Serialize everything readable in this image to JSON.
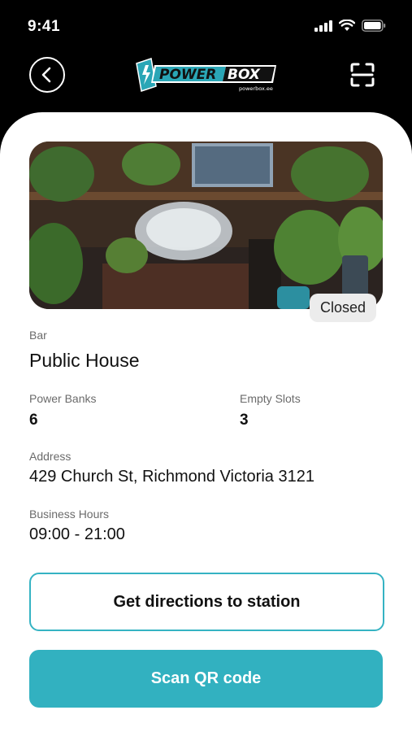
{
  "status_bar": {
    "time": "9:41"
  },
  "header": {
    "logo_text_a": "POWER",
    "logo_text_b": "BOX",
    "logo_subtext": "powerbox.ee",
    "back_icon": "chevron-left-icon",
    "scan_icon": "scan-frame-icon"
  },
  "station": {
    "status_badge": "Closed",
    "category": "Bar",
    "name": "Public House",
    "power_banks_label": "Power Banks",
    "power_banks_value": "6",
    "empty_slots_label": "Empty Slots",
    "empty_slots_value": "3",
    "address_label": "Address",
    "address_value": "429 Church St, Richmond Victoria 3121",
    "hours_label": "Business Hours",
    "hours_value": "09:00 - 21:00"
  },
  "actions": {
    "directions_label": "Get directions to station",
    "scan_label": "Scan QR code"
  },
  "colors": {
    "accent": "#32b1c0",
    "header_bg": "#000000",
    "sheet_bg": "#ffffff"
  }
}
